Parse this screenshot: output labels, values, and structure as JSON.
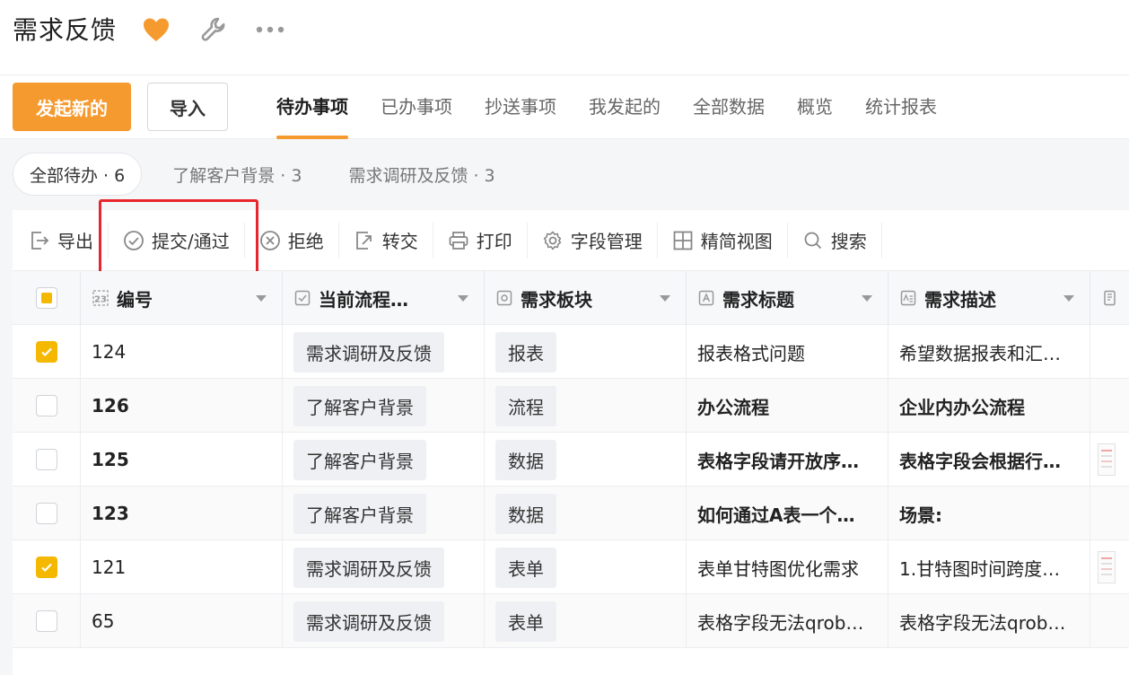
{
  "app": {
    "title": "需求反馈"
  },
  "nav": {
    "new_button": "发起新的",
    "import_button": "导入",
    "tabs": [
      "待办事项",
      "已办事项",
      "抄送事项",
      "我发起的",
      "全部数据",
      "概览",
      "统计报表"
    ],
    "active_tab": 0
  },
  "filters": [
    {
      "label": "全部待办 · 6",
      "active": true
    },
    {
      "label": "了解客户背景 · 3",
      "active": false
    },
    {
      "label": "需求调研及反馈 · 3",
      "active": false
    }
  ],
  "toolbar": {
    "export": "导出",
    "submit": "提交/通过",
    "reject": "拒绝",
    "transfer": "转交",
    "print": "打印",
    "fields": "字段管理",
    "compact": "精简视图",
    "search": "搜索"
  },
  "table": {
    "columns": [
      "编号",
      "当前流程…",
      "需求板块",
      "需求标题",
      "需求描述"
    ],
    "rows": [
      {
        "checked": true,
        "id": "124",
        "stage": "需求调研及反馈",
        "module": "报表",
        "title": "报表格式问题",
        "desc": "希望数据报表和汇…",
        "thumb": false,
        "bold": false
      },
      {
        "checked": false,
        "id": "126",
        "stage": "了解客户背景",
        "module": "流程",
        "title": "办公流程",
        "desc": "企业内办公流程",
        "thumb": false,
        "bold": true
      },
      {
        "checked": false,
        "id": "125",
        "stage": "了解客户背景",
        "module": "数据",
        "title": "表格字段请开放序…",
        "desc": "表格字段会根据行…",
        "thumb": true,
        "bold": true
      },
      {
        "checked": false,
        "id": "123",
        "stage": "了解客户背景",
        "module": "数据",
        "title": "如何通过A表一个…",
        "desc": "场景:",
        "thumb": false,
        "bold": true
      },
      {
        "checked": true,
        "id": "121",
        "stage": "需求调研及反馈",
        "module": "表单",
        "title": "表单甘特图优化需求",
        "desc": "1.甘特图时间跨度…",
        "thumb": true,
        "bold": false
      },
      {
        "checked": false,
        "id": "65",
        "stage": "需求调研及反馈",
        "module": "表单",
        "title": "表格字段无法qrob…",
        "desc": "表格字段无法qrob…",
        "thumb": false,
        "bold": false
      }
    ]
  },
  "colors": {
    "accent": "#f59a2f",
    "check": "#f5b800",
    "highlight": "#e8252a"
  },
  "icons": [
    "heart-icon",
    "wrench-icon",
    "more-icon",
    "export-icon",
    "check-circle-icon",
    "close-circle-icon",
    "transfer-icon",
    "printer-icon",
    "gear-icon",
    "grid-icon",
    "search-icon"
  ]
}
